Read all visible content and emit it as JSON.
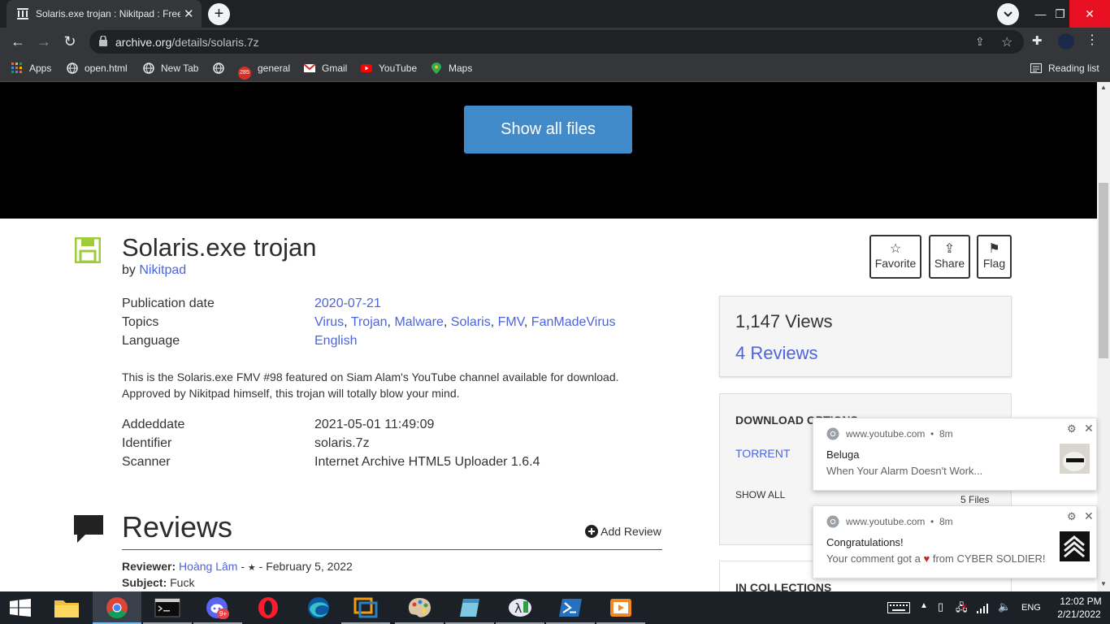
{
  "browser": {
    "tab_title": "Solaris.exe trojan : Nikitpad : Free",
    "url_host": "archive.org",
    "url_path": "/details/solaris.7z",
    "bookmarks": [
      "Apps",
      "open.html",
      "New Tab",
      "",
      "general",
      "Gmail",
      "YouTube",
      "Maps"
    ],
    "reading_list": "Reading list",
    "gmail_badge": "285"
  },
  "theater": {
    "show_all_files": "Show all files"
  },
  "item": {
    "title": "Solaris.exe trojan",
    "by_label": "by",
    "author": "Nikitpad",
    "actions": {
      "favorite": "Favorite",
      "share": "Share",
      "flag": "Flag"
    },
    "metadata": {
      "publication_date_label": "Publication date",
      "publication_date": "2020-07-21",
      "topics_label": "Topics",
      "topics": [
        "Virus",
        "Trojan",
        "Malware",
        "Solaris",
        "FMV",
        "FanMadeVirus"
      ],
      "language_label": "Language",
      "language": "English"
    },
    "description_line1": "This is the Solaris.exe FMV #98 featured on Siam Alam's YouTube channel available for download.",
    "description_line2": "Approved by Nikitpad himself, this trojan will totally blow your mind.",
    "details": {
      "addeddate_label": "Addeddate",
      "addeddate": "2021-05-01 11:49:09",
      "identifier_label": "Identifier",
      "identifier": "solaris.7z",
      "scanner_label": "Scanner",
      "scanner": "Internet Archive HTML5 Uploader 1.6.4"
    }
  },
  "reviews": {
    "heading": "Reviews",
    "add_review": "Add Review",
    "reviewer_label": "Reviewer:",
    "reviewer": "Hoàng Lâm",
    "rating_sep": " - ",
    "stars": "★",
    "date": " - February 5, 2022",
    "subject_label": "Subject:",
    "subject": "Fuck"
  },
  "sidebar": {
    "views": "1,147 Views",
    "reviews": "4 Reviews",
    "download_title": "DOWNLOAD OPTIONS",
    "torrent": "TORRENT",
    "show_all": "SHOW ALL",
    "files": "5 Files",
    "collections_title": "IN COLLECTIONS"
  },
  "notifications": [
    {
      "source": "www.youtube.com",
      "age": "8m",
      "title": "Beluga",
      "body": "When Your Alarm Doesn't Work..."
    },
    {
      "source": "www.youtube.com",
      "age": "8m",
      "title": "Congratulations!",
      "body_pre": "Your comment got a",
      "body_heart": "♥",
      "body_post": "from CYBER SOLDIER!"
    }
  ],
  "taskbar": {
    "lang": "ENG",
    "time": "12:02 PM",
    "date": "2/21/2022",
    "discord_badge": "9+"
  },
  "colors": {
    "link": "#4b64de",
    "button": "#428bca",
    "taskbar": "#1c2128"
  }
}
